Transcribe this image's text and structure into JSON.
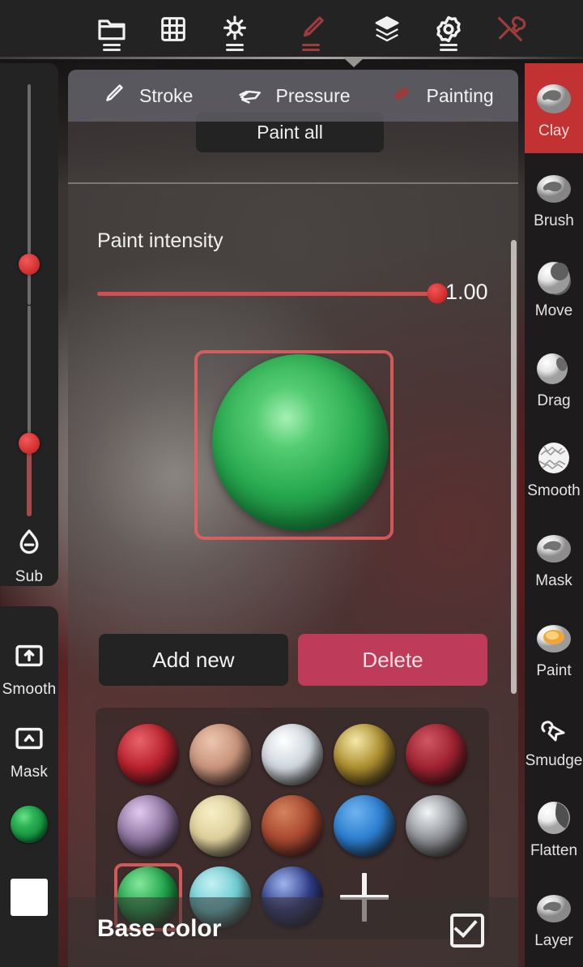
{
  "app": {
    "accent_red": "#c33232",
    "panel_bg": "rgba(74,70,68,0.55)",
    "delete_color": "#bf3b5a"
  },
  "topbar": {
    "items": [
      {
        "icon": "folder-icon",
        "name": "files",
        "active": false,
        "has_dash": true,
        "red": false
      },
      {
        "icon": "grid-icon",
        "name": "scene-grid",
        "active": false,
        "has_dash": false,
        "red": false
      },
      {
        "icon": "light-icon",
        "name": "lighting",
        "active": false,
        "has_dash": true,
        "red": false
      },
      {
        "icon": "brush-icon",
        "name": "brush",
        "active": true,
        "has_dash": true,
        "red": true
      },
      {
        "icon": "layers-icon",
        "name": "layers",
        "active": false,
        "has_dash": false,
        "red": false
      },
      {
        "icon": "gear-icon",
        "name": "settings",
        "active": false,
        "has_dash": true,
        "red": false
      },
      {
        "icon": "tools-icon",
        "name": "tools",
        "active": true,
        "has_dash": false,
        "red": true
      }
    ]
  },
  "left_sidebar": {
    "sliders": [
      {
        "name": "radius-slider",
        "value_pct": 62
      },
      {
        "name": "intensity-slider",
        "value_pct": 36
      }
    ],
    "tools": [
      {
        "label": "Sub",
        "icon": "drop-minus-icon",
        "name": "sub-mode"
      },
      {
        "label": "Smooth",
        "icon": "square-up-arrow-icon",
        "name": "smooth-shortcut"
      },
      {
        "label": "Mask",
        "icon": "square-caret-icon",
        "name": "mask-shortcut"
      }
    ],
    "swatches": [
      {
        "name": "material-color-swatch",
        "type": "sphere",
        "color": "#22a84c"
      },
      {
        "name": "secondary-color-swatch",
        "type": "square",
        "color": "#ffffff"
      }
    ]
  },
  "right_sidebar": {
    "tools": [
      {
        "label": "Clay",
        "active": true,
        "icon": "clay-icon"
      },
      {
        "label": "Brush",
        "active": false,
        "icon": "brush-icon"
      },
      {
        "label": "Move",
        "active": false,
        "icon": "move-icon"
      },
      {
        "label": "Drag",
        "active": false,
        "icon": "drag-icon"
      },
      {
        "label": "Smooth",
        "active": false,
        "icon": "smooth-icon"
      },
      {
        "label": "Mask",
        "active": false,
        "icon": "mask-icon"
      },
      {
        "label": "Paint",
        "active": false,
        "icon": "paint-icon"
      },
      {
        "label": "Smudge",
        "active": false,
        "icon": "smudge-icon"
      },
      {
        "label": "Flatten",
        "active": false,
        "icon": "flatten-icon"
      },
      {
        "label": "Layer",
        "active": false,
        "icon": "layer-icon"
      }
    ]
  },
  "panel": {
    "tabs": [
      {
        "label": "Stroke",
        "icon": "stroke-icon",
        "active": false
      },
      {
        "label": "Pressure",
        "icon": "pressure-icon",
        "active": false
      },
      {
        "label": "Painting",
        "icon": "painting-icon",
        "active": true
      }
    ],
    "paint_all_button": "Paint all",
    "intensity": {
      "label": "Paint intensity",
      "value": "1.00",
      "value_pct": 100
    },
    "actions": {
      "add_label": "Add new",
      "delete_label": "Delete"
    },
    "materials": [
      {
        "name": "material-crimson",
        "color": "#b8212c",
        "hi": "#e8636b",
        "selected": false
      },
      {
        "name": "material-peach",
        "color": "#c8937a",
        "hi": "#ecc5ae",
        "selected": false
      },
      {
        "name": "material-porcelain",
        "color": "#cdd5dc",
        "hi": "#ffffff",
        "selected": false
      },
      {
        "name": "material-gold",
        "color": "#ab8c2e",
        "hi": "#f4e8a8",
        "selected": false
      },
      {
        "name": "material-darkred",
        "color": "#9e2230",
        "hi": "#d05662",
        "selected": false
      },
      {
        "name": "material-lilac",
        "color": "#8d74a0",
        "hi": "#e0c8ee",
        "selected": false
      },
      {
        "name": "material-cream",
        "color": "#ddcf9a",
        "hi": "#f7efc8",
        "selected": false
      },
      {
        "name": "material-terracotta",
        "color": "#a8482e",
        "hi": "#d4825e",
        "selected": false
      },
      {
        "name": "material-blue",
        "color": "#2b7ed0",
        "hi": "#6fb3ee",
        "selected": false
      },
      {
        "name": "material-chrome",
        "color": "#8d9196",
        "hi": "#f2f4f6",
        "selected": false
      },
      {
        "name": "material-green",
        "color": "#1ea34a",
        "hi": "#86e79c",
        "selected": true
      },
      {
        "name": "material-cyan",
        "color": "#6dcdd4",
        "hi": "#c4f0f2",
        "selected": false
      },
      {
        "name": "material-navy",
        "color": "#2f3d86",
        "hi": "#9fb4ef",
        "selected": false
      }
    ],
    "add_material_label": "+",
    "bottom": {
      "label": "Base color",
      "checked": true
    }
  }
}
